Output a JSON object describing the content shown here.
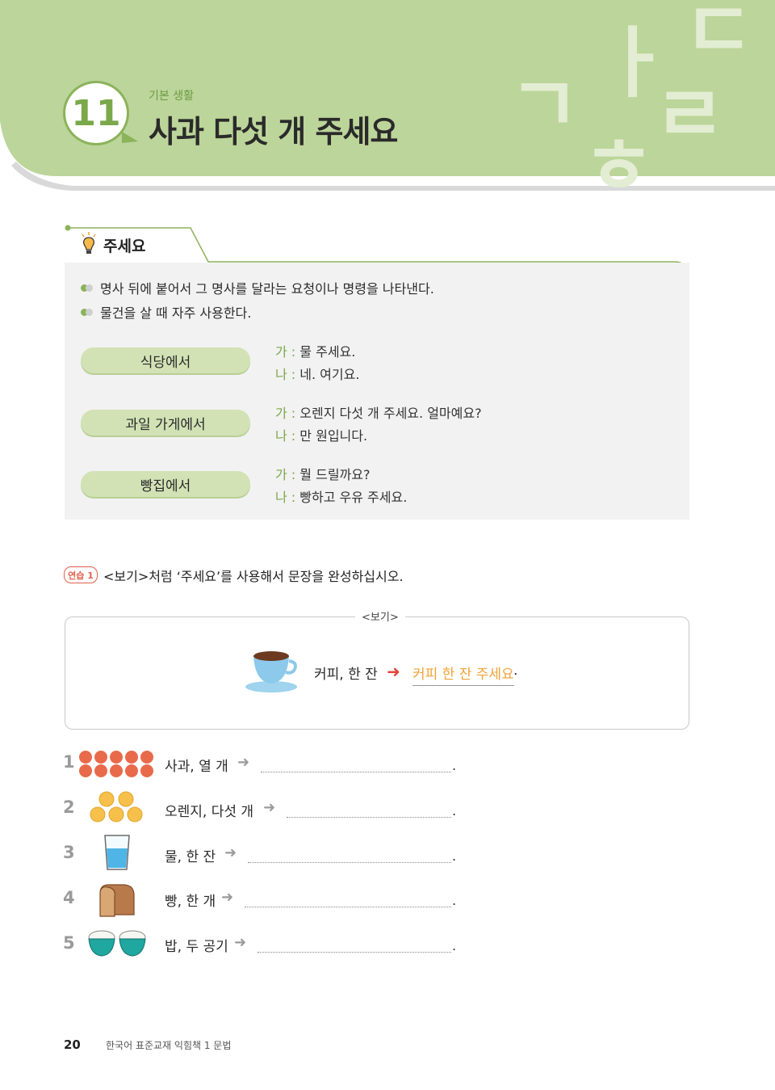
{
  "header": {
    "lesson_number": "11",
    "category": "기본 생활",
    "title": "사과 다섯 개 주세요",
    "deco_letters": [
      "ㄱ",
      "ㅏ",
      "ㄷ",
      "ㄹ",
      "ㅎ"
    ]
  },
  "grammar": {
    "title": "주세요",
    "bullets": [
      "명사 뒤에 붙어서 그 명사를 달라는 요청이나 명령을 나타낸다.",
      "물건을 살 때 자주 사용한다."
    ],
    "examples": [
      {
        "place": "식당에서",
        "lines": [
          {
            "speaker": "가 :",
            "text": " 물 주세요."
          },
          {
            "speaker": "나 :",
            "text": " 네. 여기요."
          }
        ]
      },
      {
        "place": "과일 가게에서",
        "lines": [
          {
            "speaker": "가 :",
            "text": " 오렌지 다섯 개 주세요. 얼마예요?"
          },
          {
            "speaker": "나 :",
            "text": " 만 원입니다."
          }
        ]
      },
      {
        "place": "빵집에서",
        "lines": [
          {
            "speaker": "가 :",
            "text": " 뭘 드릴까요?"
          },
          {
            "speaker": "나 :",
            "text": " 빵하고 우유 주세요."
          }
        ]
      }
    ]
  },
  "practice": {
    "badge": "연습 1",
    "instruction": "<보기>처럼 ‘주세요’를 사용해서 문장을 완성하십시오.",
    "example_label": "<보기>",
    "example_prompt": "커피, 한 잔",
    "example_arrow": "➜",
    "example_answer": "커피 한 잔 주세요",
    "example_period": ".",
    "items": [
      {
        "num": "1",
        "prompt": "사과, 열 개",
        "icon": "apples-icon"
      },
      {
        "num": "2",
        "prompt": "오렌지, 다섯 개",
        "icon": "oranges-icon"
      },
      {
        "num": "3",
        "prompt": "물, 한 잔",
        "icon": "water-glass-icon"
      },
      {
        "num": "4",
        "prompt": "빵, 한 개",
        "icon": "bread-icon"
      },
      {
        "num": "5",
        "prompt": "밥, 두 공기",
        "icon": "rice-bowls-icon"
      }
    ],
    "item_arrow": "➜",
    "item_period": "."
  },
  "footer": {
    "page_number": "20",
    "book_title": "한국어 표준교재 익힘책 1 문법"
  },
  "colors": {
    "header_green": "#bcd59a",
    "accent_green": "#8bb35a",
    "pill_green": "#d2e2b5",
    "answer_orange": "#f0a33a",
    "arrow_red": "#e2443a",
    "box_gray": "#f2f2f2"
  }
}
